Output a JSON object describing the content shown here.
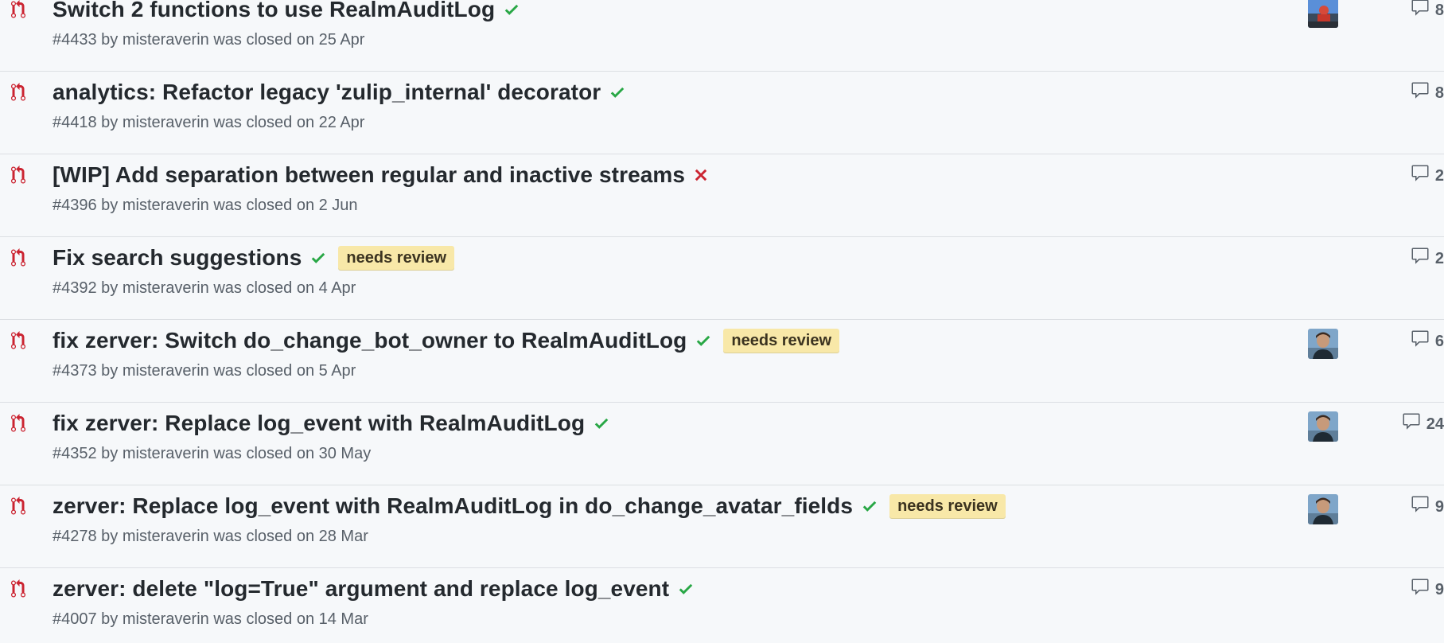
{
  "colors": {
    "closed_icon": "#cb2431",
    "check": "#28a745",
    "cross": "#cb2431",
    "label_bg": "#f8e8a8"
  },
  "pull_requests": [
    {
      "title": "Switch 2 functions to use RealmAuditLog",
      "status": "success",
      "label": "",
      "number": "#4433",
      "meta_text": " by misteraverin was closed on 25 Apr",
      "avatar": "avatar-outdoor-icon",
      "comments": "8"
    },
    {
      "title": "analytics: Refactor legacy 'zulip_internal' decorator",
      "status": "success",
      "label": "",
      "number": "#4418",
      "meta_text": " by misteraverin was closed on 22 Apr",
      "avatar": "",
      "comments": "8"
    },
    {
      "title": "[WIP] Add separation between regular and inactive streams",
      "status": "failure",
      "label": "",
      "number": "#4396",
      "meta_text": " by misteraverin was closed on 2 Jun",
      "avatar": "",
      "comments": "2"
    },
    {
      "title": "Fix search suggestions",
      "status": "success",
      "label": "needs review",
      "number": "#4392",
      "meta_text": " by misteraverin was closed on 4 Apr",
      "avatar": "",
      "comments": "2"
    },
    {
      "title": "fix zerver: Switch do_change_bot_owner to RealmAuditLog",
      "status": "success",
      "label": "needs review",
      "number": "#4373",
      "meta_text": " by misteraverin was closed on 5 Apr",
      "avatar": "avatar-person-icon",
      "comments": "6"
    },
    {
      "title": "fix zerver: Replace log_event with RealmAuditLog",
      "status": "success",
      "label": "",
      "number": "#4352",
      "meta_text": " by misteraverin was closed on 30 May",
      "avatar": "avatar-person-icon",
      "comments": "24"
    },
    {
      "title": "zerver: Replace log_event with RealmAuditLog in do_change_avatar_fields",
      "status": "success",
      "label": "needs review",
      "number": "#4278",
      "meta_text": " by misteraverin was closed on 28 Mar",
      "avatar": "avatar-person-icon",
      "comments": "9"
    },
    {
      "title": "zerver: delete \"log=True\" argument and replace log_event",
      "status": "success",
      "label": "",
      "number": "#4007",
      "meta_text": " by misteraverin was closed on 14 Mar",
      "avatar": "",
      "comments": "9"
    }
  ]
}
